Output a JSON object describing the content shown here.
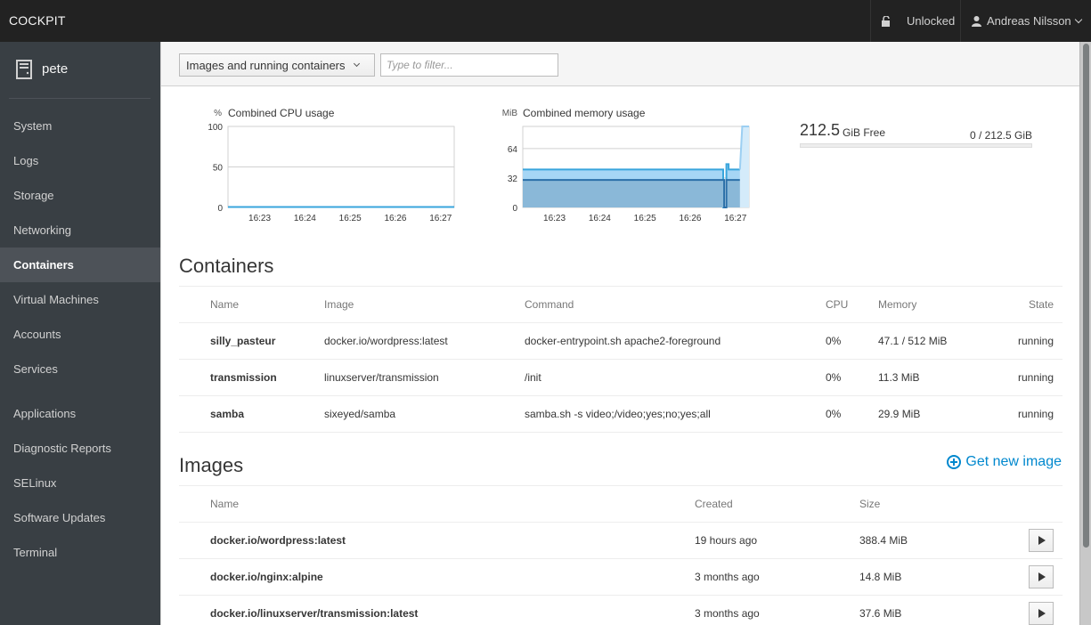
{
  "topbar": {
    "brand": "COCKPIT",
    "lock_label": "Unlocked",
    "user_label": "Andreas Nilsson"
  },
  "sidebar": {
    "hostname": "pete",
    "items": [
      {
        "label": "System",
        "active": false
      },
      {
        "label": "Logs",
        "active": false
      },
      {
        "label": "Storage",
        "active": false
      },
      {
        "label": "Networking",
        "active": false
      },
      {
        "label": "Containers",
        "active": true
      },
      {
        "label": "Virtual Machines",
        "active": false
      },
      {
        "label": "Accounts",
        "active": false
      },
      {
        "label": "Services",
        "active": false
      },
      {
        "label": "Applications",
        "active": false
      },
      {
        "label": "Diagnostic Reports",
        "active": false
      },
      {
        "label": "SELinux",
        "active": false
      },
      {
        "label": "Software Updates",
        "active": false
      },
      {
        "label": "Terminal",
        "active": false
      }
    ]
  },
  "toolbar": {
    "filter_select": "Images and running containers",
    "filter_placeholder": "Type to filter...",
    "filter_value": ""
  },
  "chart_data": [
    {
      "type": "line",
      "title": "Combined CPU usage",
      "ylabel": "%",
      "ylim": [
        0,
        100
      ],
      "yticks": [
        "100",
        "50",
        "0"
      ],
      "xticks": [
        "16:23",
        "16:24",
        "16:25",
        "16:26",
        "16:27"
      ],
      "x": [
        0,
        0.25,
        0.5,
        0.75,
        1.0,
        1.25,
        1.5,
        1.75,
        2.0,
        2.25,
        2.5,
        2.75,
        3.0,
        3.25,
        3.5,
        3.75,
        4.0,
        4.25,
        4.5,
        4.75,
        5.0
      ],
      "series": [
        {
          "name": "CPU",
          "values": [
            0.5,
            0.5,
            0.6,
            0.5,
            0.5,
            0.5,
            0.6,
            0.5,
            0.5,
            0.5,
            0.5,
            0.5,
            0.5,
            0.6,
            0.5,
            0.5,
            0.5,
            0.5,
            0.5,
            0.5,
            0.5
          ]
        }
      ],
      "grid": true
    },
    {
      "type": "area",
      "title": "Combined memory usage",
      "ylabel": "MiB",
      "ylim": [
        0,
        88
      ],
      "yticks": [
        "64",
        "32",
        "0"
      ],
      "xticks": [
        "16:23",
        "16:24",
        "16:25",
        "16:26",
        "16:27"
      ],
      "series": [
        {
          "name": "samba",
          "points": [
            [
              0,
              29.9
            ],
            [
              4.45,
              29.9
            ],
            [
              4.45,
              0
            ],
            [
              4.5,
              0
            ],
            [
              4.5,
              29.9
            ],
            [
              5.0,
              29.9
            ]
          ]
        },
        {
          "name": "transmission",
          "points": [
            [
              0,
              41.2
            ],
            [
              4.43,
              41.2
            ],
            [
              4.43,
              0
            ],
            [
              4.5,
              0
            ],
            [
              4.5,
              47
            ],
            [
              4.55,
              47
            ],
            [
              4.55,
              41.2
            ],
            [
              5.0,
              41.2
            ]
          ]
        },
        {
          "name": "silly_pasteur",
          "points": [
            [
              4.8,
              41.2
            ],
            [
              4.85,
              88
            ],
            [
              5.0,
              88
            ]
          ]
        }
      ],
      "grid": true
    }
  ],
  "disk": {
    "free_value": "212.5",
    "free_label": "GiB Free",
    "total": "0 / 212.5 GiB",
    "used_fraction": 0
  },
  "containers": {
    "title": "Containers",
    "columns": [
      "Name",
      "Image",
      "Command",
      "CPU",
      "Memory",
      "State"
    ],
    "rows": [
      {
        "name": "silly_pasteur",
        "image": "docker.io/wordpress:latest",
        "command": "docker-entrypoint.sh apache2-foreground",
        "cpu": "0%",
        "memory": "47.1 / 512 MiB",
        "state": "running"
      },
      {
        "name": "transmission",
        "image": "linuxserver/transmission",
        "command": "/init",
        "cpu": "0%",
        "memory": "11.3 MiB",
        "state": "running"
      },
      {
        "name": "samba",
        "image": "sixeyed/samba",
        "command": "samba.sh -s video;/video;yes;no;yes;all",
        "cpu": "0%",
        "memory": "29.9 MiB",
        "state": "running"
      }
    ]
  },
  "images": {
    "title": "Images",
    "get_new_label": "Get new image",
    "columns": [
      "Name",
      "Created",
      "Size"
    ],
    "rows": [
      {
        "name": "docker.io/wordpress:latest",
        "created": "19 hours ago",
        "size": "388.4 MiB"
      },
      {
        "name": "docker.io/nginx:alpine",
        "created": "3 months ago",
        "size": "14.8 MiB"
      },
      {
        "name": "docker.io/linuxserver/transmission:latest",
        "created": "3 months ago",
        "size": "37.6 MiB"
      }
    ]
  },
  "colors": {
    "accent": "#0088ce",
    "topbar": "#222222",
    "sidebar": "#393f44",
    "sidebar_active": "#4d5258"
  }
}
